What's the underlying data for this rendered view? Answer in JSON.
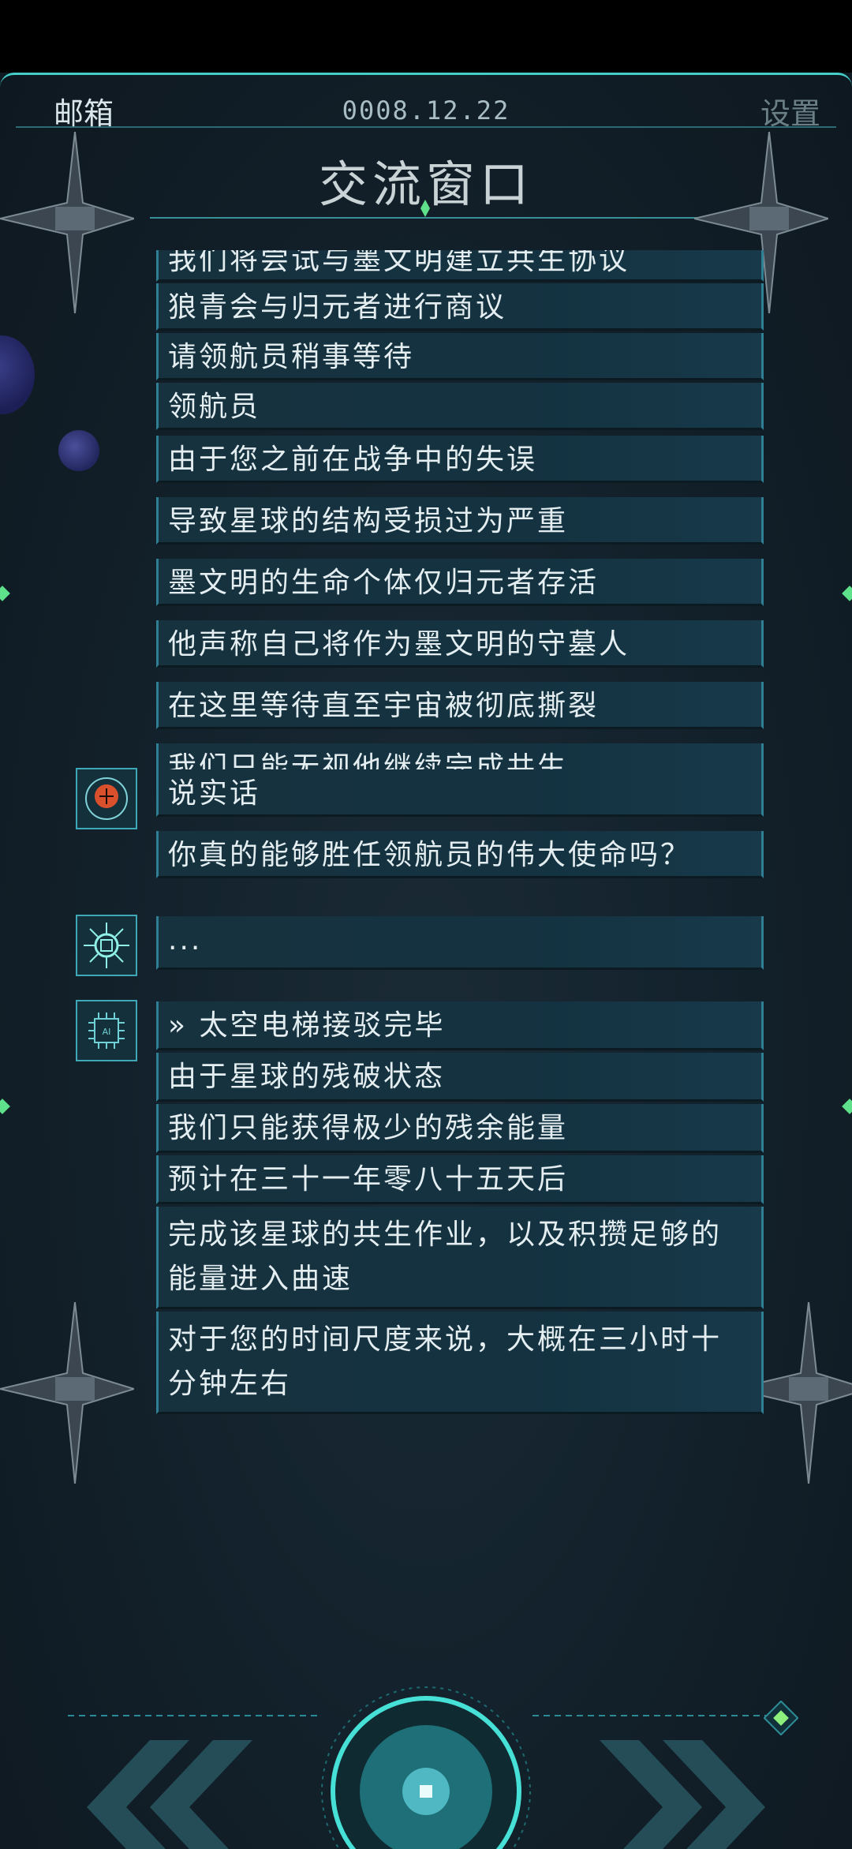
{
  "header": {
    "mail_label": "邮箱",
    "date": "0008.12.22",
    "settings_label": "设置",
    "title": "交流窗口"
  },
  "messages": [
    {
      "text": "我们将尝试与墨文明建立共生协议"
    },
    {
      "text": "狼青会与归元者进行商议"
    },
    {
      "text": "请领航员稍事等待"
    },
    {
      "text": "领航员"
    },
    {
      "text": "由于您之前在战争中的失误"
    },
    {
      "text": "导致星球的结构受损过为严重"
    },
    {
      "text": "墨文明的生命个体仅归元者存活"
    },
    {
      "text": "他声称自己将作为墨文明的守墓人"
    },
    {
      "text": "在这里等待直至宇宙被彻底撕裂"
    },
    {
      "text": "我们只能无视他继续完成共生"
    },
    {
      "text": "说实话"
    },
    {
      "text": "你真的能够胜任领航员的伟大使命吗？"
    },
    {
      "text": "..."
    },
    {
      "text": "» 太空电梯接驳完毕"
    },
    {
      "text": "由于星球的残破状态"
    },
    {
      "text": "我们只能获得极少的残余能量"
    },
    {
      "text": "预计在三十一年零八十五天后"
    },
    {
      "text": "完成该星球的共生作业，以及积攒足够的能量进入曲速"
    },
    {
      "text": "对于您的时间尺度来说，大概在三小时十分钟左右"
    }
  ],
  "avatars": [
    {
      "icon": "brain-icon"
    },
    {
      "icon": "chip-icon"
    },
    {
      "icon": "ai-chip-icon"
    }
  ],
  "controls": {
    "prev_icon": "double-chevron-left-icon",
    "next_icon": "double-chevron-right-icon",
    "center_icon": "center-orb-button-icon",
    "gem_icon": "green-gem-icon"
  },
  "colors": {
    "accent": "#43cfc7",
    "bubble": "#143240",
    "bubble_border": "#2f7e93",
    "text": "#e4eef1"
  }
}
